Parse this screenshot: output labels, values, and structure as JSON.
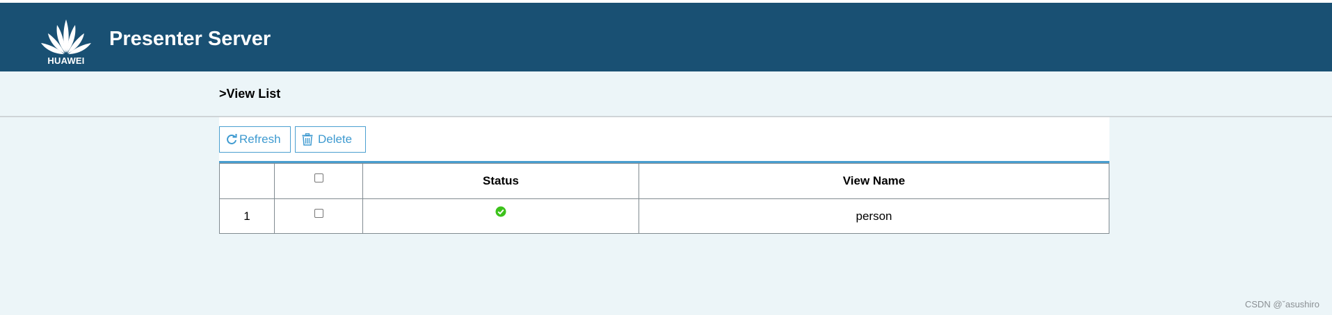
{
  "brand": {
    "logo_text": "HUAWEI",
    "app_title": "Presenter Server"
  },
  "breadcrumb": {
    "label": ">View List"
  },
  "toolbar": {
    "refresh_label": "Refresh",
    "delete_label": "Delete"
  },
  "table": {
    "columns": [
      "",
      "",
      "Status",
      "View Name"
    ],
    "rows": [
      {
        "index": "1",
        "checked": false,
        "status": "ok",
        "view_name": "person"
      }
    ]
  },
  "watermark": "CSDN @ˇasushiro",
  "colors": {
    "header_bg": "#195073",
    "page_bg": "#ecf5f8",
    "accent": "#3e9ad0",
    "status_ok": "#3cc21b"
  }
}
